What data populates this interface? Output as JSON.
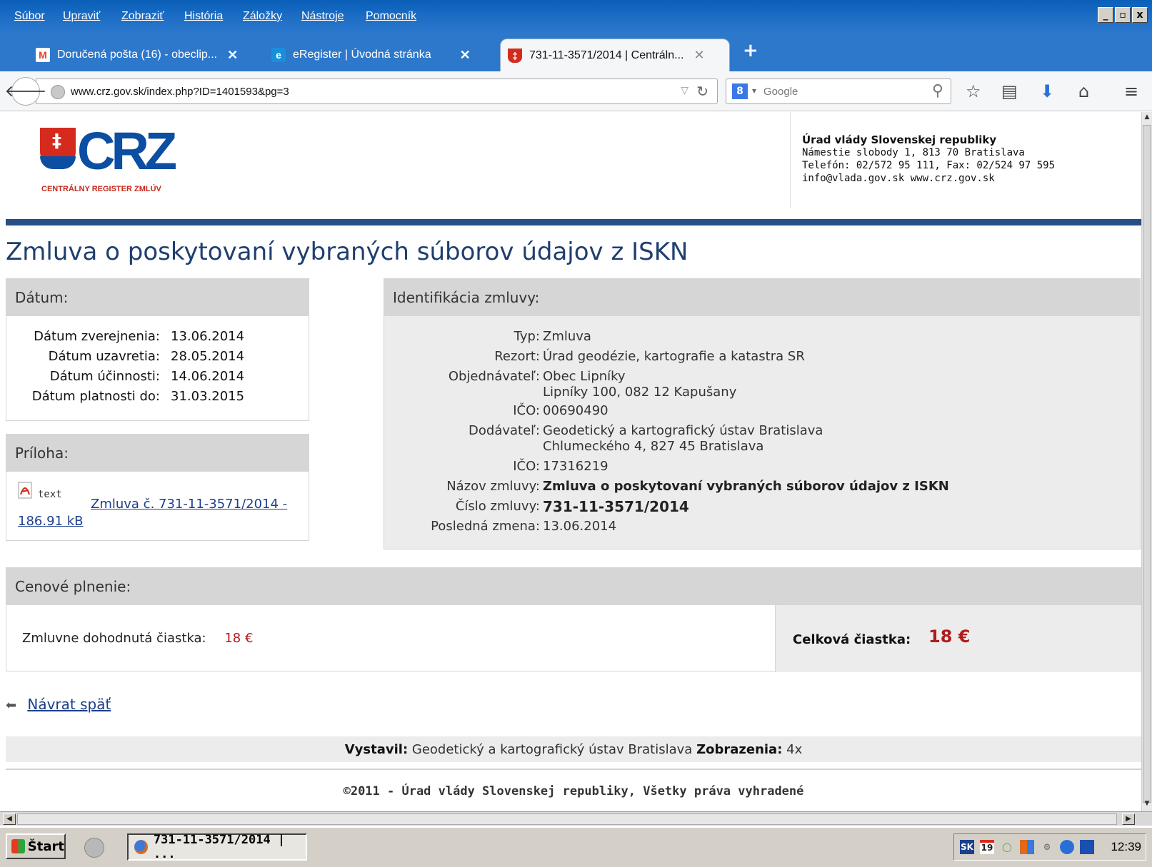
{
  "menubar": {
    "items": [
      "Súbor",
      "Upraviť",
      "Zobraziť",
      "História",
      "Záložky",
      "Nástroje",
      "Pomocník"
    ],
    "window_controls": [
      "_",
      "▫",
      "x"
    ]
  },
  "tabs": [
    {
      "label": "Doručená pošta (16) - obeclip...",
      "icon": "gmail-icon",
      "close": "✕"
    },
    {
      "label": "eRegister | Úvodná stránka",
      "icon": "ie-icon",
      "close": "✕"
    },
    {
      "label": "731-11-3571/2014 | Centráln...",
      "icon": "crz-shield-icon",
      "close": "✕",
      "active": true
    }
  ],
  "navbar": {
    "url": "www.crz.gov.sk/index.php?ID=1401593&pg=3",
    "search_engine": "8",
    "search_placeholder": "Google"
  },
  "header": {
    "logo_text": "CRZ",
    "logo_tagline": "CENTRÁLNY REGISTER ZMLÚV",
    "office_name": "Úrad vlády Slovenskej republiky",
    "office_lines": [
      "Námestie slobody 1, 813 70 Bratislava",
      "Telefón: 02/572 95 111, Fax: 02/524 97 595",
      "info@vlada.gov.sk  www.crz.gov.sk"
    ]
  },
  "page_title": "Zmluva o poskytovaní vybraných súborov údajov z ISKN",
  "dates": {
    "heading": "Dátum:",
    "rows": [
      {
        "label": "Dátum zverejnenia:",
        "value": "13.06.2014"
      },
      {
        "label": "Dátum uzavretia:",
        "value": "28.05.2014"
      },
      {
        "label": "Dátum účinnosti:",
        "value": "14.06.2014"
      },
      {
        "label": "Dátum platnosti do:",
        "value": "31.03.2015"
      }
    ]
  },
  "identification": {
    "heading": "Identifikácia zmluvy:",
    "typ_label": "Typ:",
    "typ": "Zmluva",
    "rezort_label": "Rezort:",
    "rezort": "Úrad geodézie, kartografie a katastra SR",
    "objednavatel_label": "Objednávateľ:",
    "objednavatel": "Obec Lipníky",
    "objednavatel_addr": "Lipníky 100, 082 12 Kapušany",
    "ico1_label": "IČO:",
    "ico1": "00690490",
    "dodavatel_label": "Dodávateľ:",
    "dodavatel": "Geodetický a kartografický ústav Bratislava",
    "dodavatel_addr": "Chlumeckého 4, 827 45 Bratislava",
    "ico2_label": "IČO:",
    "ico2": "17316219",
    "nazov_label": "Názov zmluvy:",
    "nazov": "Zmluva o poskytovaní vybraných súborov údajov z ISKN",
    "cislo_label": "Číslo zmluvy:",
    "cislo": "731-11-3571/2014",
    "zmena_label": "Posledná zmena:",
    "zmena": "13.06.2014"
  },
  "annex": {
    "heading": "Príloha:",
    "type": "text",
    "link": "Zmluva č. 731-11-3571/2014 - 186.91 kB"
  },
  "price": {
    "heading": "Cenové plnenie:",
    "agreed_label": "Zmluvne dohodnutá čiastka:",
    "agreed_value": "18 €",
    "total_label": "Celková čiastka:",
    "total_value": "18 €"
  },
  "back_link": "Návrat späť",
  "footer": {
    "issued_label": "Vystavil:",
    "issued_value": "Geodetický a kartografický ústav Bratislava",
    "views_label": "Zobrazenia:",
    "views_value": "4x",
    "copyright": "©2011 - Úrad vlády Slovenskej republiky, Všetky práva vyhradené"
  },
  "taskbar": {
    "start": "Štart",
    "task": "731-11-3571/2014 | ...",
    "tray_lang": "SK",
    "tray_date": "19",
    "clock": "12:39"
  }
}
